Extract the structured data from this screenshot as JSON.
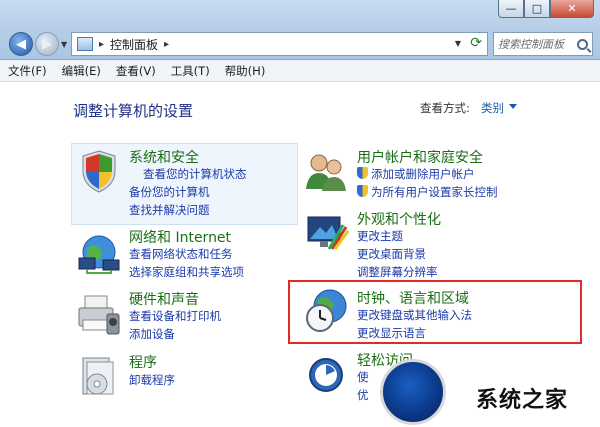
{
  "window": {
    "controls": {
      "minimize": "—",
      "maximize": "□",
      "close": "✕"
    }
  },
  "nav": {
    "back_glyph": "◀",
    "forward_glyph": "▶",
    "dropdown_glyph": "▼"
  },
  "address": {
    "separator": "▸",
    "path": "控制面板",
    "trail": "▸",
    "refresh_glyph": "⟳"
  },
  "search": {
    "placeholder": "搜索控制面板"
  },
  "menubar": [
    "文件(F)",
    "编辑(E)",
    "查看(V)",
    "工具(T)",
    "帮助(H)"
  ],
  "page": {
    "title": "调整计算机的设置",
    "view_by_label": "查看方式:",
    "view_by_value": "类别"
  },
  "categories": {
    "security": {
      "title": "系统和安全",
      "links": [
        "查看您的计算机状态",
        "备份您的计算机",
        "查找并解决问题"
      ]
    },
    "network": {
      "title": "网络和 Internet",
      "links": [
        "查看网络状态和任务",
        "选择家庭组和共享选项"
      ]
    },
    "hardware": {
      "title": "硬件和声音",
      "links": [
        "查看设备和打印机",
        "添加设备"
      ]
    },
    "programs": {
      "title": "程序",
      "links": [
        "卸载程序"
      ]
    },
    "users": {
      "title": "用户帐户和家庭安全",
      "links": [
        "添加或删除用户帐户",
        "为所有用户设置家长控制"
      ]
    },
    "appearance": {
      "title": "外观和个性化",
      "links": [
        "更改主题",
        "更改桌面背景",
        "调整屏幕分辨率"
      ]
    },
    "clock": {
      "title": "时钟、语言和区域",
      "links": [
        "更改键盘或其他输入法",
        "更改显示语言"
      ]
    },
    "ease": {
      "title": "轻松访问",
      "links": [
        "使",
        "优"
      ]
    }
  },
  "watermark": {
    "text": "系统之家"
  },
  "colors": {
    "link": "#1b3aa8",
    "category_title": "#1b6e16",
    "highlight_box": "#e32a26"
  }
}
